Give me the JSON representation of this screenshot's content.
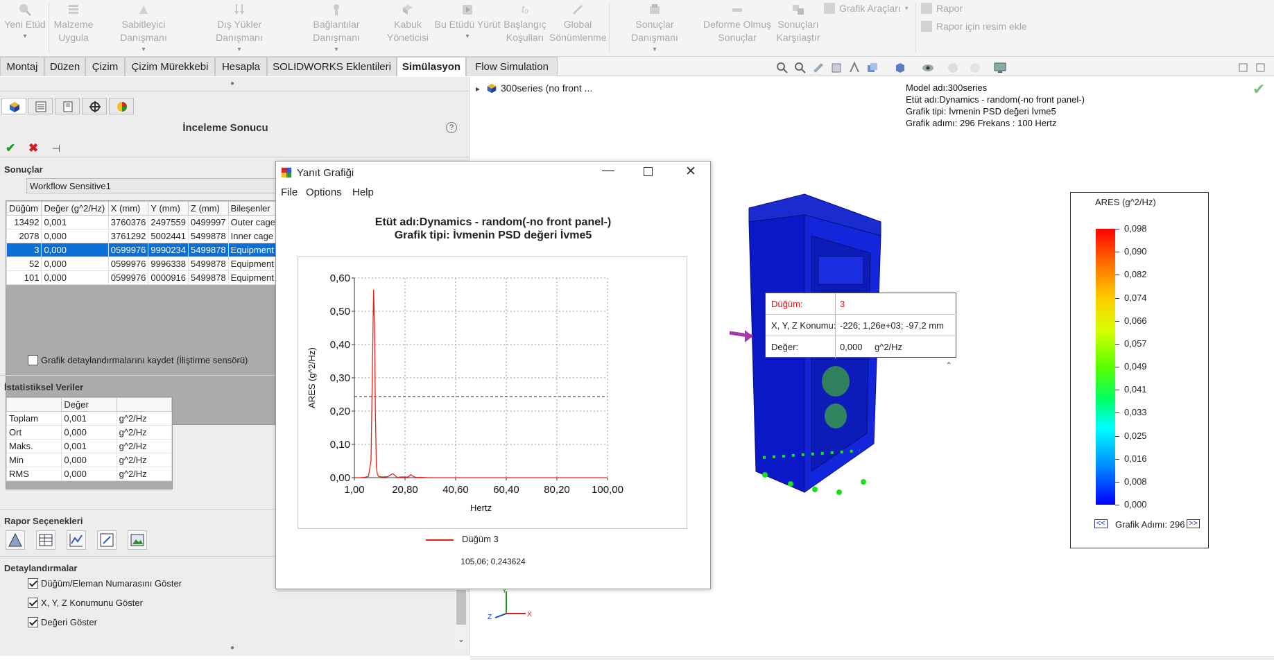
{
  "ribbon": {
    "buttons": [
      {
        "label1": "Yeni Etüd",
        "label2": "",
        "icon": "new-study-icon"
      },
      {
        "label1": "Malzeme",
        "label2": "Uygula",
        "icon": "material-icon"
      },
      {
        "label1": "Sabitleyici Danışmanı",
        "label2": "",
        "icon": "fixture-icon"
      },
      {
        "label1": "Dış Yükler Danışmanı",
        "label2": "",
        "icon": "load-icon"
      },
      {
        "label1": "Bağlantılar Danışmanı",
        "label2": "",
        "icon": "connection-icon"
      },
      {
        "label1": "Kabuk",
        "label2": "Yöneticisi",
        "icon": "shell-icon"
      },
      {
        "label1": "Bu Etüdü Yürüt",
        "label2": "",
        "icon": "run-icon"
      },
      {
        "label1": "Başlangıç",
        "label2": "Koşulları",
        "icon": "initial-condition-icon"
      },
      {
        "label1": "Global",
        "label2": "Sönümlenme",
        "icon": "damping-icon"
      },
      {
        "label1": "Sonuçlar Danışmanı",
        "label2": "",
        "icon": "results-icon"
      },
      {
        "label1": "Deforme Olmuş",
        "label2": "Sonuçlar",
        "icon": "deformed-icon"
      },
      {
        "label1": "Sonuçları",
        "label2": "Karşılaştır",
        "icon": "compare-icon"
      }
    ],
    "plot_tools": "Grafik Araçları",
    "report": "Rapor",
    "add_image": "Rapor için resim ekle"
  },
  "tabs": [
    {
      "label": "Montaj"
    },
    {
      "label": "Düzen"
    },
    {
      "label": "Çizim"
    },
    {
      "label": "Çizim Mürekkebi"
    },
    {
      "label": "Hesapla"
    },
    {
      "label": "SOLIDWORKS Eklentileri"
    },
    {
      "label": "Simülasyon"
    },
    {
      "label": "Flow Simulation"
    }
  ],
  "panel": {
    "title": "İnceleme Sonucu",
    "results_label": "Sonuçlar",
    "results_value": "Workflow Sensitive1",
    "results_columns": [
      "Düğüm",
      "Değer (g^2/Hz)",
      "X (mm)",
      "Y (mm)",
      "Z (mm)",
      "Bileşenler"
    ],
    "results_rows": [
      [
        "13492",
        "0,001",
        "3760376",
        "2497559",
        "0499997",
        "Outer cage"
      ],
      [
        "2078",
        "0,000",
        "3761292",
        "5002441",
        "5499878",
        "Inner cage"
      ],
      [
        "3",
        "0,000",
        "0599976",
        "9990234",
        "5499878",
        "Equipment"
      ],
      [
        "52",
        "0,000",
        "0599976",
        "9996338",
        "5499878",
        "Equipment"
      ],
      [
        "101",
        "0,000",
        "0599976",
        "0000916",
        "5499878",
        "Equipment"
      ]
    ],
    "save_plot_label": "Grafik detaylandırmalarını kaydet (İliştirme sensörü)",
    "stats_title": "İstatistiksel Veriler",
    "stats_header": "Değer",
    "stats_rows": [
      [
        "Toplam",
        "0,001",
        "g^2/Hz"
      ],
      [
        "Ort",
        "0,000",
        "g^2/Hz"
      ],
      [
        "Maks.",
        "0,001",
        "g^2/Hz"
      ],
      [
        "Min",
        "0,000",
        "g^2/Hz"
      ],
      [
        "RMS",
        "0,000",
        "g^2/Hz"
      ]
    ],
    "report_title": "Rapor Seçenekleri",
    "detail_title": "Detaylandırmalar",
    "options": [
      {
        "label": "Düğüm/Eleman Numarasını Göster",
        "checked": true
      },
      {
        "label": "X, Y, Z Konumunu Göster",
        "checked": true
      },
      {
        "label": "Değeri Göster",
        "checked": true
      }
    ]
  },
  "tree": {
    "node": "300series  (no front ..."
  },
  "info": {
    "line1": "Model adı:300series",
    "line2": "Etüt adı:Dynamics - random(-no front panel-)",
    "line3": "Grafik tipi: İvmenin PSD değeri İvme5",
    "line4": "Grafik adımı: 296 Frekans : 100 Hertz"
  },
  "tooltip": {
    "k1": "Düğüm:",
    "v1": "3",
    "k2": "X, Y, Z Konumu:",
    "v2": "-226; 1,26e+03; -97,2 mm",
    "k3": "Değer:",
    "v3": "0,000",
    "u3": "g^2/Hz"
  },
  "legend": {
    "title": "ARES (g^2/Hz)",
    "labels": [
      "0,098",
      "0,090",
      "0,082",
      "0,074",
      "0,066",
      "0,057",
      "0,049",
      "0,041",
      "0,033",
      "0,025",
      "0,016",
      "0,008",
      "0,000"
    ],
    "prev": "<<",
    "next": ">>",
    "step": "Grafik Adımı: 296"
  },
  "triad": {
    "x": "X",
    "y": "Y",
    "z": "Z"
  },
  "dialog": {
    "title": "Yanıt Grafiği",
    "menu": [
      "File",
      "Options",
      "Help"
    ],
    "readout": "105,06; 0,243624"
  },
  "chart_data": {
    "type": "line",
    "title": "Etüt adı:Dynamics - random(-no front panel-)",
    "subtitle": "Grafik tipi: İvmenin PSD değeri İvme5",
    "xlabel": "Hertz",
    "ylabel": "ARES (g^2/Hz)",
    "xlim": [
      1.0,
      100.0
    ],
    "ylim": [
      0.0,
      0.6
    ],
    "xticks": [
      "1,00",
      "20,80",
      "40,60",
      "60,40",
      "80,20",
      "100,00"
    ],
    "yticks": [
      "0,00",
      "0,10",
      "0,20",
      "0,30",
      "0,40",
      "0,50",
      "0,60"
    ],
    "grid": true,
    "reference_line": 0.243624,
    "legend_position": "bottom",
    "series": [
      {
        "name": "Düğüm 3",
        "color": "#e8201b",
        "x": [
          1.0,
          3.0,
          5.0,
          6.5,
          7.5,
          8.0,
          8.5,
          8.9,
          9.2,
          9.6,
          10.0,
          10.5,
          11.0,
          12.0,
          14.0,
          16.0,
          17.0,
          17.5,
          18.0,
          19.0,
          22.0,
          23.0,
          24.0,
          25.0,
          27.0,
          30.0,
          40.0,
          60.0,
          80.0,
          100.0
        ],
        "y": [
          0.0,
          0.0,
          0.001,
          0.004,
          0.05,
          0.3,
          0.565,
          0.45,
          0.2,
          0.03,
          0.01,
          0.004,
          0.003,
          0.002,
          0.003,
          0.012,
          0.006,
          0.002,
          0.001,
          0.002,
          0.002,
          0.009,
          0.004,
          0.001,
          0.001,
          0.0,
          0.0,
          0.0,
          0.0,
          0.0
        ]
      }
    ]
  },
  "colors": {
    "accent": "#0a6fd6",
    "series": "#e8201b",
    "model": "#0a14d8"
  }
}
